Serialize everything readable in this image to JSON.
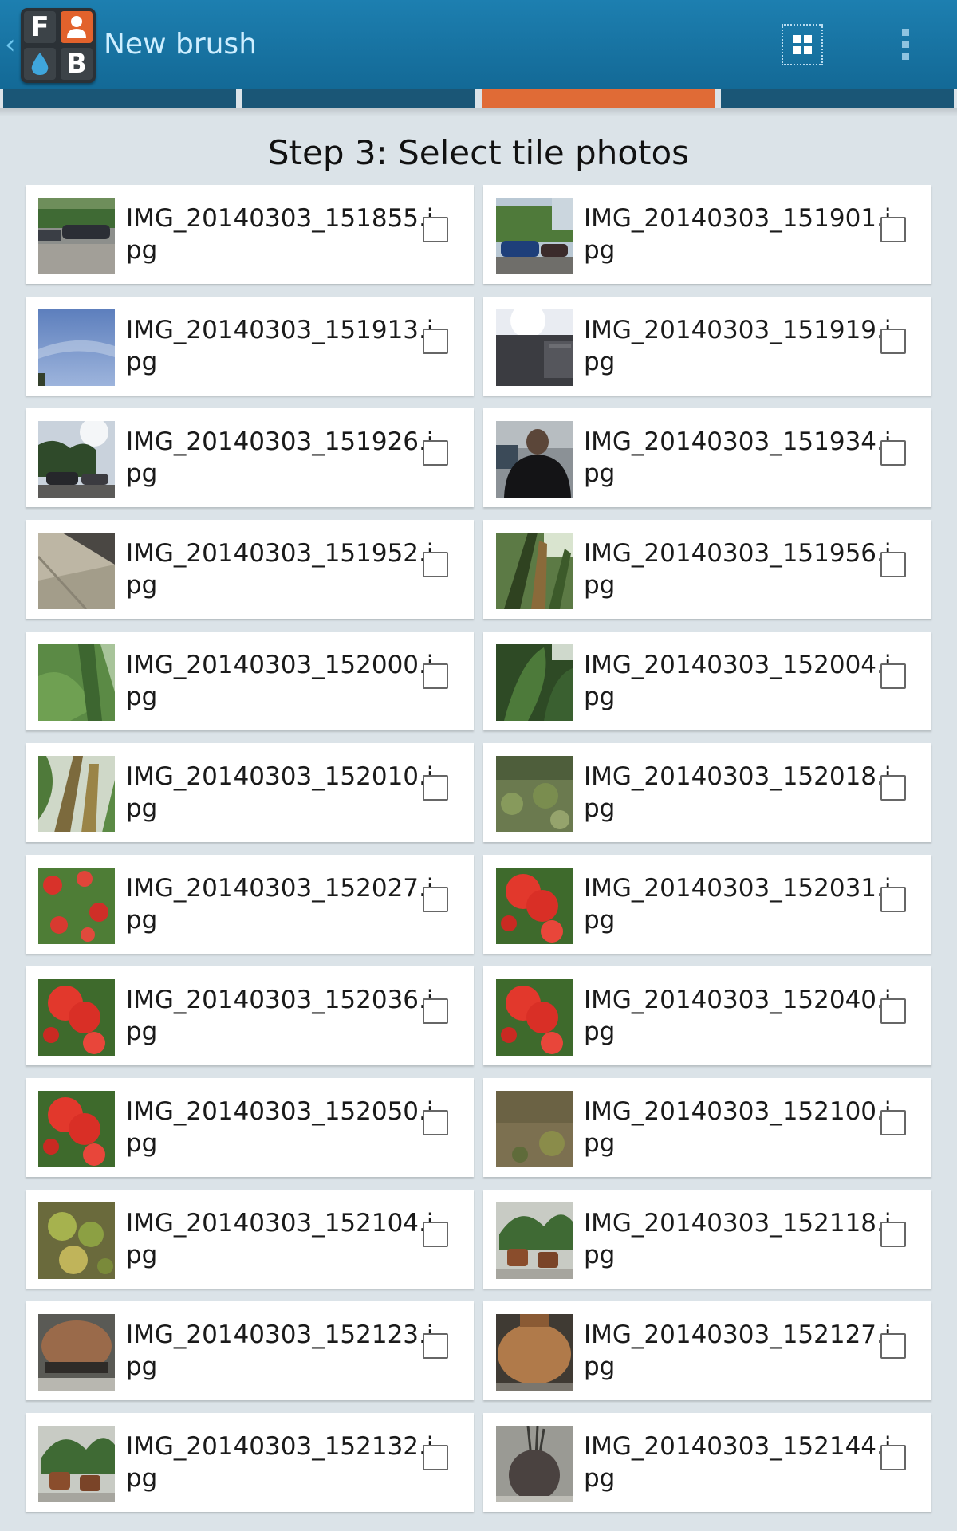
{
  "action_bar": {
    "title": "New brush",
    "logo_letters": {
      "top_left": "F",
      "bottom_right": "B"
    },
    "icons": {
      "up": "chevron-left-icon",
      "grid_view": "grid-view-icon",
      "overflow": "overflow-menu-icon"
    }
  },
  "tabs": {
    "count": 4,
    "active_index": 2,
    "active_color": "#e06b36",
    "inactive_color": "#1a5676"
  },
  "heading": "Step 3: Select tile photos",
  "photos": [
    {
      "name_line1": "IMG_20140303_151855.j",
      "name_line2": "pg",
      "thumb": "parking-lot",
      "checked": false
    },
    {
      "name_line1": "IMG_20140303_151901.j",
      "name_line2": "pg",
      "thumb": "cars-trees",
      "checked": false
    },
    {
      "name_line1": "IMG_20140303_151913.j",
      "name_line2": "pg",
      "thumb": "blue-sky",
      "checked": false
    },
    {
      "name_line1": "IMG_20140303_151919.j",
      "name_line2": "pg",
      "thumb": "building-bright-sky",
      "checked": false
    },
    {
      "name_line1": "IMG_20140303_151926.j",
      "name_line2": "pg",
      "thumb": "trees-cars",
      "checked": false
    },
    {
      "name_line1": "IMG_20140303_151934.j",
      "name_line2": "pg",
      "thumb": "person",
      "checked": false
    },
    {
      "name_line1": "IMG_20140303_151952.j",
      "name_line2": "pg",
      "thumb": "pavement",
      "checked": false
    },
    {
      "name_line1": "IMG_20140303_151956.j",
      "name_line2": "pg",
      "thumb": "palm",
      "checked": false
    },
    {
      "name_line1": "IMG_20140303_152000.j",
      "name_line2": "pg",
      "thumb": "banana-leaves",
      "checked": false
    },
    {
      "name_line1": "IMG_20140303_152004.j",
      "name_line2": "pg",
      "thumb": "dark-leaves",
      "checked": false
    },
    {
      "name_line1": "IMG_20140303_152010.j",
      "name_line2": "pg",
      "thumb": "palm-trunk",
      "checked": false
    },
    {
      "name_line1": "IMG_20140303_152018.j",
      "name_line2": "pg",
      "thumb": "shrubs",
      "checked": false
    },
    {
      "name_line1": "IMG_20140303_152027.j",
      "name_line2": "pg",
      "thumb": "red-flowers-green",
      "checked": false
    },
    {
      "name_line1": "IMG_20140303_152031.j",
      "name_line2": "pg",
      "thumb": "red-flowers",
      "checked": false
    },
    {
      "name_line1": "IMG_20140303_152036.j",
      "name_line2": "pg",
      "thumb": "red-flowers",
      "checked": false
    },
    {
      "name_line1": "IMG_20140303_152040.j",
      "name_line2": "pg",
      "thumb": "red-flowers",
      "checked": false
    },
    {
      "name_line1": "IMG_20140303_152050.j",
      "name_line2": "pg",
      "thumb": "red-flowers",
      "checked": false
    },
    {
      "name_line1": "IMG_20140303_152100.j",
      "name_line2": "pg",
      "thumb": "dirt-ground",
      "checked": false
    },
    {
      "name_line1": "IMG_20140303_152104.j",
      "name_line2": "pg",
      "thumb": "ground-plants",
      "checked": false
    },
    {
      "name_line1": "IMG_20140303_152118.j",
      "name_line2": "pg",
      "thumb": "potted-plants",
      "checked": false
    },
    {
      "name_line1": "IMG_20140303_152123.j",
      "name_line2": "pg",
      "thumb": "clay-pot",
      "checked": false
    },
    {
      "name_line1": "IMG_20140303_152127.j",
      "name_line2": "pg",
      "thumb": "clay-pot-large",
      "checked": false
    },
    {
      "name_line1": "IMG_20140303_152132.j",
      "name_line2": "pg",
      "thumb": "potted-plants",
      "checked": false
    },
    {
      "name_line1": "IMG_20140303_152144.j",
      "name_line2": "pg",
      "thumb": "round-pot",
      "checked": false
    }
  ]
}
